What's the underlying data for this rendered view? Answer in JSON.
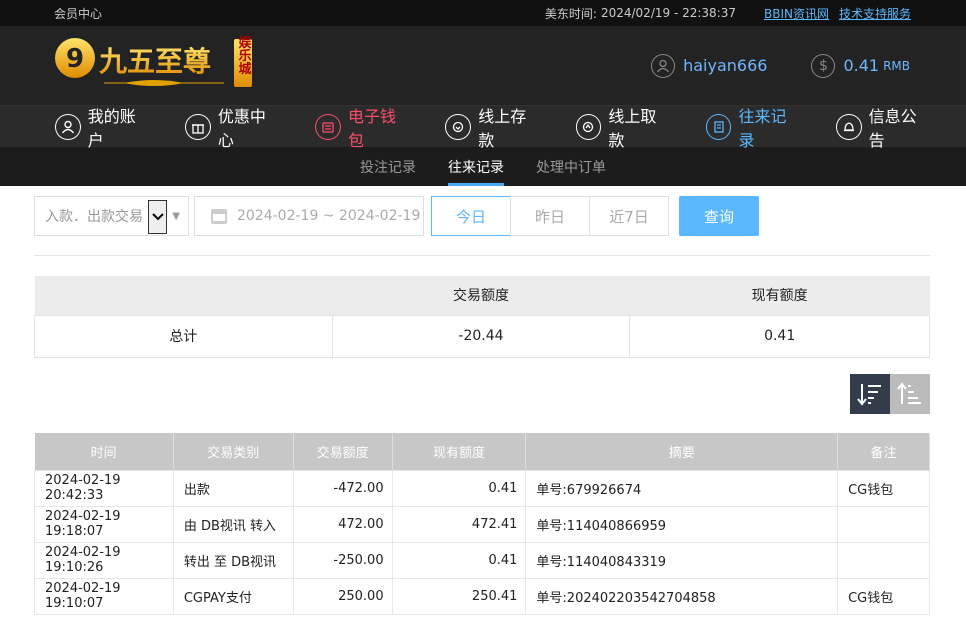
{
  "topbar": {
    "member_center": "会员中心",
    "time_label": "美东时间:",
    "time_value": "2024/02/19 - 22:38:37",
    "link_bbin": "BBIN资讯网",
    "link_support": "技术支持服务"
  },
  "header": {
    "logo_text": "九五至尊",
    "logo_badge": "娱乐城",
    "username": "haiyan666",
    "balance": "0.41",
    "balance_unit": "RMB"
  },
  "mainnav": [
    {
      "label": "我的账户",
      "icon": "user-icon",
      "state": "normal"
    },
    {
      "label": "优惠中心",
      "icon": "gift-icon",
      "state": "normal"
    },
    {
      "label": "电子钱包",
      "icon": "wallet-icon",
      "state": "red"
    },
    {
      "label": "线上存款",
      "icon": "deposit-icon",
      "state": "normal"
    },
    {
      "label": "线上取款",
      "icon": "withdraw-icon",
      "state": "normal"
    },
    {
      "label": "往来记录",
      "icon": "record-icon",
      "state": "active"
    },
    {
      "label": "信息公告",
      "icon": "bell-icon",
      "state": "normal"
    }
  ],
  "subnav": [
    {
      "label": "投注记录"
    },
    {
      "label": "往来记录"
    },
    {
      "label": "处理中订单"
    }
  ],
  "filters": {
    "type_value": "入款．出款交易",
    "date_range": "2024-02-19 ~ 2024-02-19",
    "btn_today": "今日",
    "btn_yesterday": "昨日",
    "btn_7days": "近7日",
    "btn_query": "查询"
  },
  "summary": {
    "col_amount": "交易额度",
    "col_balance": "现有额度",
    "row_label": "总计",
    "amount": "-20.44",
    "balance": "0.41"
  },
  "detail": {
    "headers": [
      "时间",
      "交易类别",
      "交易额度",
      "现有额度",
      "摘要",
      "备注"
    ],
    "rows": [
      [
        "2024-02-19 20:42:33",
        "出款",
        "-472.00",
        "0.41",
        "单号:679926674",
        "CG钱包"
      ],
      [
        "2024-02-19 19:18:07",
        "由 DB视讯 转入",
        "472.00",
        "472.41",
        "单号:114040866959",
        ""
      ],
      [
        "2024-02-19 19:10:26",
        "转出 至 DB视讯",
        "-250.00",
        "0.41",
        "单号:114040843319",
        ""
      ],
      [
        "2024-02-19 19:10:07",
        "CGPAY支付",
        "250.00",
        "250.41",
        "单号:202402203542704858",
        "CG钱包"
      ]
    ]
  },
  "colors": {
    "accent_blue": "#5bb8ff",
    "accent_red": "#ff4d6a",
    "gold": "#f2b51c"
  }
}
